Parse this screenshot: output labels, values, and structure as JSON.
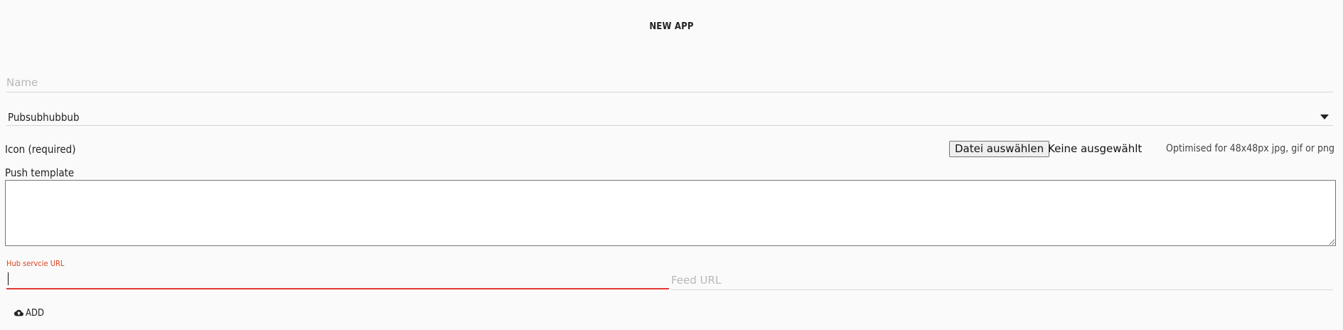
{
  "header": {
    "title": "NEW APP"
  },
  "form": {
    "name": {
      "placeholder": "Name",
      "value": ""
    },
    "type_select": {
      "selected": "Pubsubhubbub",
      "icon": "caret-down-icon"
    },
    "icon_upload": {
      "label": "Icon (required)",
      "button_label": "Datei auswählen",
      "status": "Keine ausgewählt",
      "hint": "Optimised for 48x48px jpg, gif or png"
    },
    "push_template": {
      "label": "Push template",
      "value": ""
    },
    "hub_url": {
      "label": "Hub servcie URL",
      "value": "",
      "accent_color": "#e53935"
    },
    "feed_url": {
      "placeholder": "Feed URL",
      "value": ""
    },
    "add_button": {
      "label": "ADD",
      "icon": "cloud-upload-icon"
    }
  }
}
